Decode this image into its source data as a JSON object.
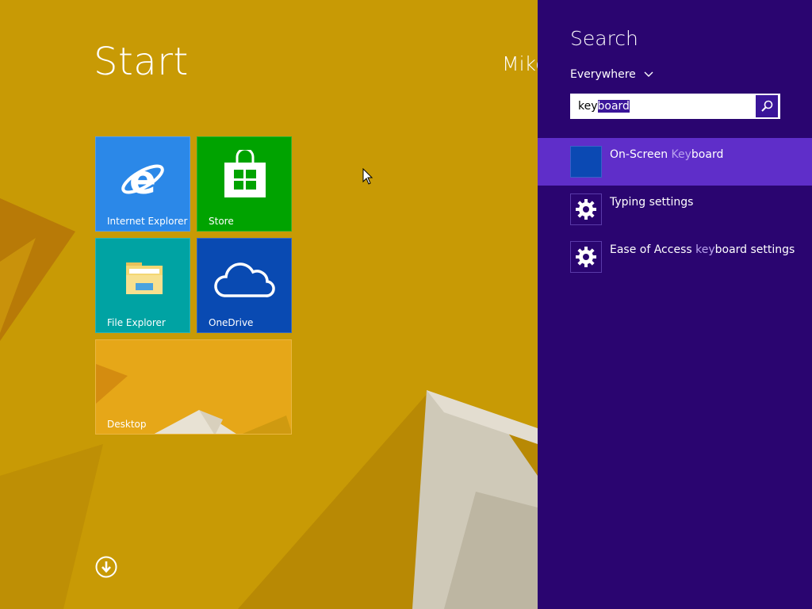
{
  "start": {
    "title": "Start",
    "user_name": "Mike",
    "tiles": [
      {
        "label": "Internet Explorer",
        "color": "#2b88e8",
        "icon": "internet-explorer-icon"
      },
      {
        "label": "Store",
        "color": "#00a300",
        "icon": "store-icon"
      },
      {
        "label": "File Explorer",
        "color": "#00a3a3",
        "icon": "folder-icon"
      },
      {
        "label": "OneDrive",
        "color": "#094ab2",
        "icon": "cloud-icon"
      },
      {
        "label": "Desktop",
        "color": "#e6a718",
        "icon": "desktop-wallpaper"
      }
    ],
    "all_apps_icon": "down-arrow-circle-icon"
  },
  "search_charm": {
    "title": "Search",
    "scope": "Everywhere",
    "query_typed": "key",
    "query_selected": "board",
    "search_icon": "magnifier-icon",
    "results": [
      {
        "label_parts": [
          "On-Screen ",
          "Key",
          "board"
        ],
        "icon": "on-screen-keyboard-icon",
        "active": true
      },
      {
        "label_parts": [
          "Typing settings",
          "",
          ""
        ],
        "icon": "gear-icon",
        "active": false
      },
      {
        "label_parts": [
          "Ease of Access ",
          "key",
          "board settings"
        ],
        "icon": "gear-icon",
        "active": false
      }
    ]
  },
  "colors": {
    "background": "#c89a05",
    "charm": "#2a0570",
    "accent": "#5f2ec9",
    "highlight": "#3a1599"
  }
}
